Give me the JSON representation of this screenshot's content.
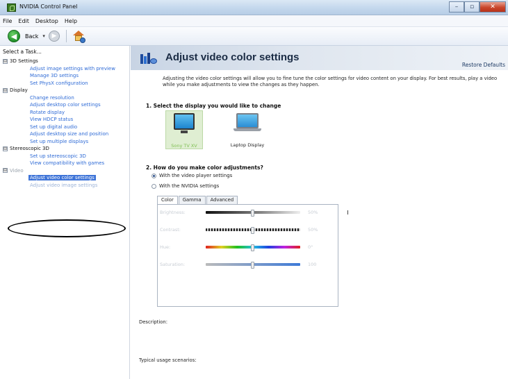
{
  "window": {
    "title": "NVIDIA Control Panel",
    "buttons": [
      "–",
      "▫",
      "✕"
    ]
  },
  "menubar": [
    "File",
    "Edit",
    "Desktop",
    "Help"
  ],
  "toolbar": {
    "back_label": "Back",
    "back_glyph": "◀",
    "forward_glyph": "▶",
    "dropdown_glyph": "▾"
  },
  "sidebar": {
    "header": "Select a Task...",
    "categories": [
      {
        "label": "3D Settings",
        "expander": "⊟",
        "items": [
          "Adjust image settings with preview",
          "Manage 3D settings",
          "Set PhysX configuration"
        ]
      },
      {
        "label": "Display",
        "expander": "⊟",
        "items": [
          "Change resolution",
          "Adjust desktop color settings",
          "Rotate display",
          "View HDCP status",
          "Set up digital audio",
          "Adjust desktop size and position",
          "Set up multiple displays"
        ]
      },
      {
        "label": "Stereoscopic 3D",
        "expander": "⊟",
        "items": [
          "Set up stereoscopic 3D",
          "View compatibility with games"
        ]
      },
      {
        "label": "Video",
        "expander": "⊟",
        "items": [
          "Adjust video color settings",
          "Adjust video image settings"
        ],
        "selected_index": 0
      }
    ]
  },
  "page": {
    "title": "Adjust video color settings",
    "restore_defaults": "Restore Defaults",
    "description": "Adjusting the video color settings will allow you to fine tune the color settings for video content on your display. For best results, play a video while you make adjustments to view the changes as they happen."
  },
  "section1": {
    "heading": "1. Select the display you would like to change",
    "displays": [
      {
        "label": "Sony TV XV",
        "selected": true
      },
      {
        "label": "Laptop Display",
        "selected": false
      }
    ]
  },
  "section2": {
    "heading": "2. How do you make color adjustments?",
    "options": [
      {
        "label": "With the video player settings",
        "checked": true
      },
      {
        "label": "With the NVIDIA settings",
        "checked": false
      }
    ],
    "tabs": [
      "Color",
      "Gamma",
      "Advanced"
    ],
    "active_tab": "Color",
    "sliders": [
      {
        "label": "Brightness:",
        "value_text": "50%",
        "level": 0.5
      },
      {
        "label": "Contrast:",
        "value_text": "50%",
        "level": 0.5
      },
      {
        "label": "Hue:",
        "value_text": "0°",
        "level": 0.5
      },
      {
        "label": "Saturation:",
        "value_text": "100",
        "level": 0.5
      }
    ]
  },
  "footer": {
    "description_label": "Description:",
    "usage_label": "Typical usage scenarios:"
  },
  "colors": {
    "link": "#2f6bd6",
    "selection": "#3e74d8",
    "selected_display_label": "#7fbf53"
  }
}
